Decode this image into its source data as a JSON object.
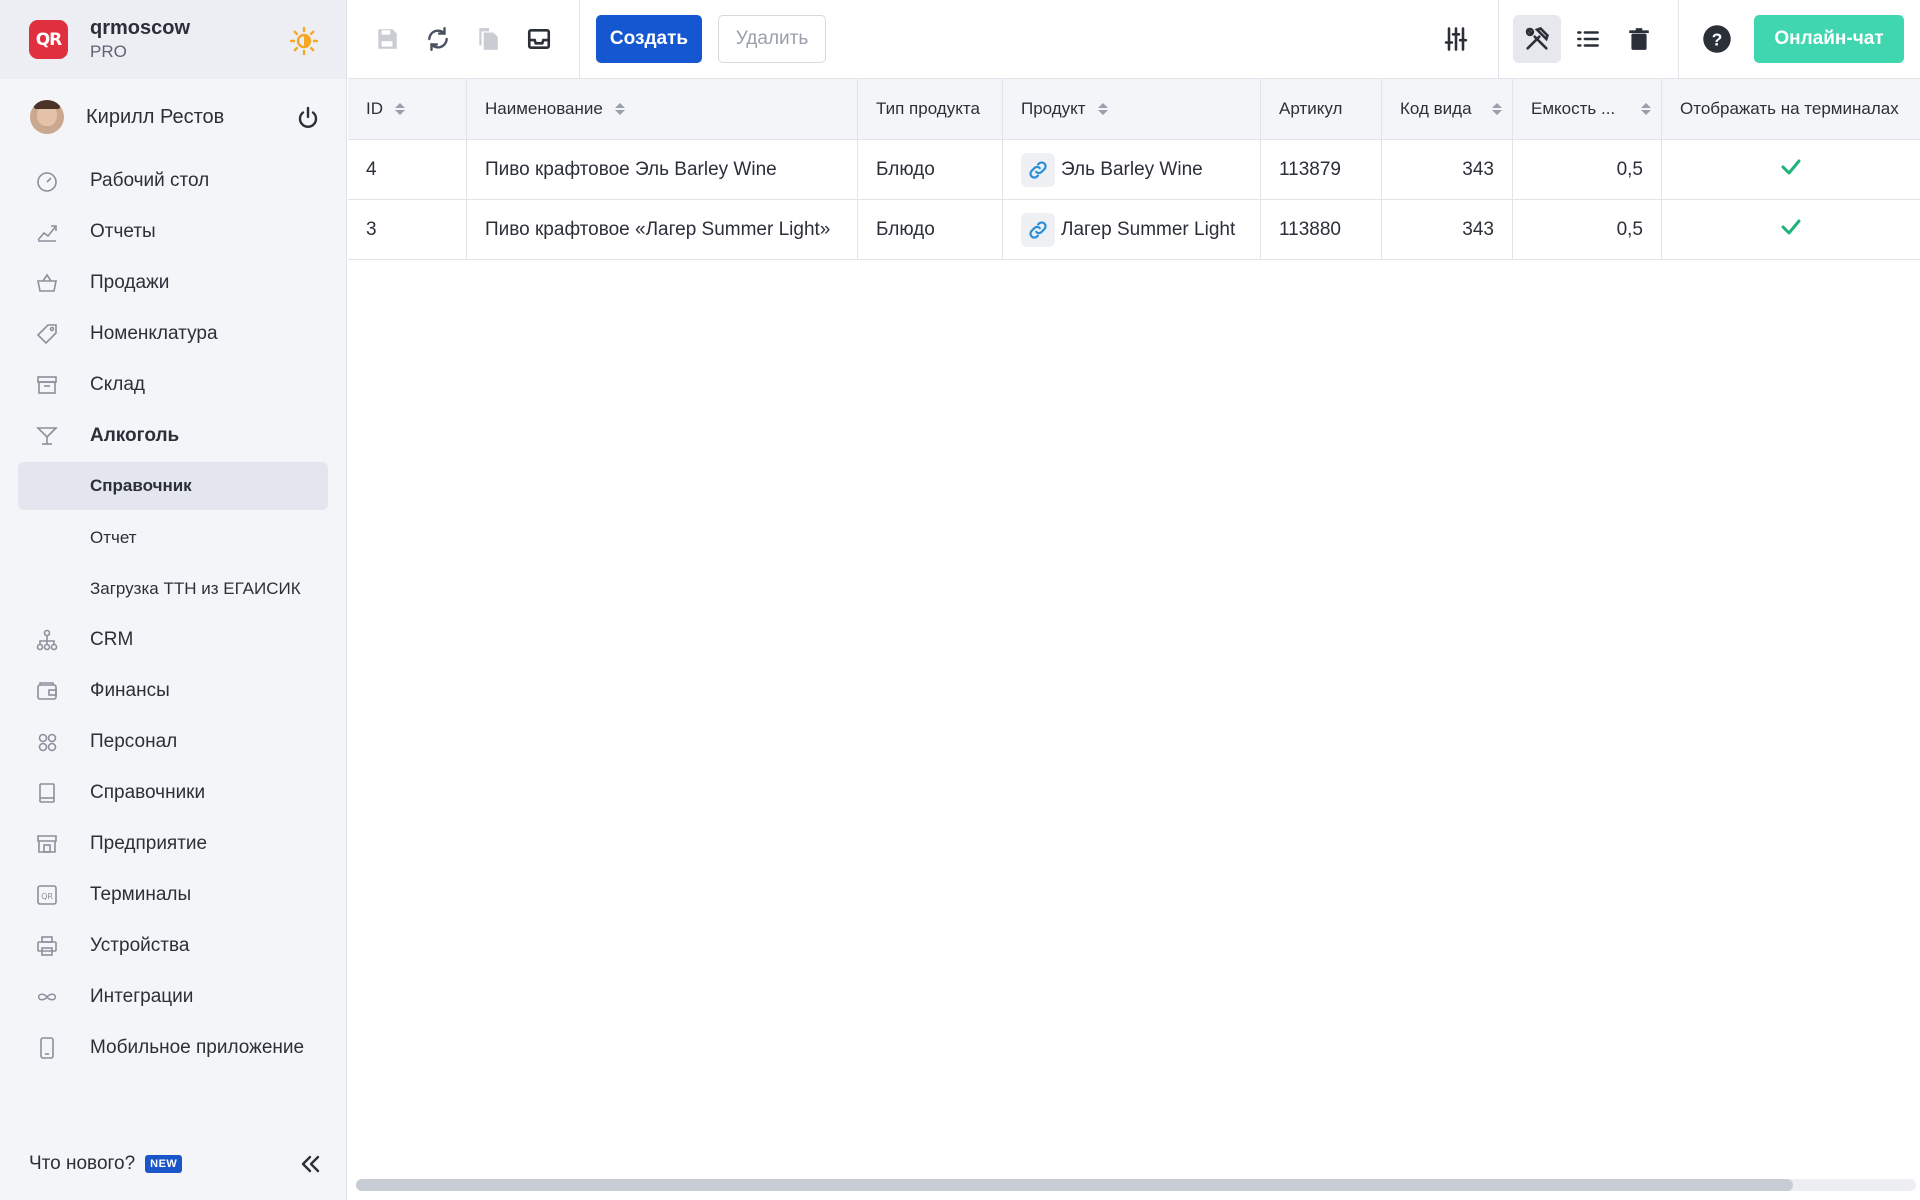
{
  "brand": {
    "logo_text": "QR",
    "name": "qrmoscow",
    "plan": "PRO"
  },
  "user": {
    "name": "Кирилл Рестов"
  },
  "nav": [
    {
      "label": "Рабочий стол",
      "icon": "dashboard-icon"
    },
    {
      "label": "Отчеты",
      "icon": "reports-icon"
    },
    {
      "label": "Продажи",
      "icon": "basket-icon"
    },
    {
      "label": "Номенклатура",
      "icon": "tag-icon"
    },
    {
      "label": "Склад",
      "icon": "warehouse-icon"
    },
    {
      "label": "Алкоголь",
      "icon": "cocktail-icon",
      "expanded": true
    }
  ],
  "nav_sub": [
    {
      "label": "Справочник",
      "active": true
    },
    {
      "label": "Отчет"
    },
    {
      "label": "Загрузка ТТН из ЕГАИСИК"
    }
  ],
  "nav_rest": [
    {
      "label": "CRM",
      "icon": "crm-icon"
    },
    {
      "label": "Финансы",
      "icon": "wallet-icon"
    },
    {
      "label": "Персонал",
      "icon": "people-icon"
    },
    {
      "label": "Справочники",
      "icon": "book-icon"
    },
    {
      "label": "Предприятие",
      "icon": "store-icon"
    },
    {
      "label": "Терминалы",
      "icon": "qr-terminal-icon"
    },
    {
      "label": "Устройства",
      "icon": "printer-icon"
    },
    {
      "label": "Интеграции",
      "icon": "infinity-icon"
    },
    {
      "label": "Мобильное приложение",
      "icon": "phone-icon"
    }
  ],
  "footer": {
    "whats_new": "Что нового?",
    "badge": "NEW"
  },
  "toolbar": {
    "create": "Создать",
    "delete": "Удалить",
    "chat": "Онлайн-чат"
  },
  "table": {
    "columns": [
      "ID",
      "Наименование",
      "Тип продукта",
      "Продукт",
      "Артикул",
      "Код вида",
      "Емкость ...",
      "Отображать на терминалах"
    ],
    "rows": [
      {
        "id": "4",
        "name": "Пиво крафтовое Эль Barley Wine",
        "type": "Блюдо",
        "product": "Эль Barley Wine",
        "article": "113879",
        "code": "343",
        "capacity": "0,5",
        "show": true
      },
      {
        "id": "3",
        "name": "Пиво крафтовое «Лагер Summer Light»",
        "type": "Блюдо",
        "product": "Лагер Summer Light",
        "article": "113880",
        "code": "343",
        "capacity": "0,5",
        "show": true
      }
    ]
  },
  "colors": {
    "accent": "#1557d0",
    "chat": "#3fd6b0",
    "check": "#1fb37a",
    "link": "#2a8fd6",
    "logo": "#e03040",
    "sun": "#f5a623"
  }
}
